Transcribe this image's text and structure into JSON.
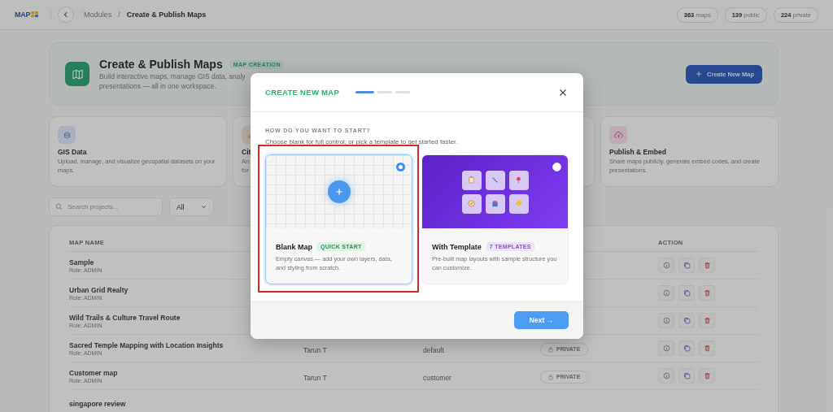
{
  "header": {
    "logo": "MAP",
    "breadcrumb_separator": "/",
    "breadcrumbs": [
      {
        "label": "Modules",
        "current": false
      },
      {
        "label": "Create & Publish Maps",
        "current": true
      }
    ],
    "stats": [
      "**363** maps",
      "**139** public",
      "**224** private"
    ]
  },
  "hero": {
    "title": "Create & Publish Maps",
    "badge": "MAP CREATION",
    "description_lines": [
      "Build interactive maps, manage GIS data, analy",
      "presentations — all in one workspace."
    ],
    "button": "Create New Map"
  },
  "feature_cards": [
    {
      "kind": "data",
      "title": "GIS Data",
      "description": "Upload, manage, and visualize geospatial datasets on your maps."
    },
    {
      "kind": "city",
      "title": "Cit",
      "description_lines": [
        "An",
        "for"
      ]
    },
    {
      "kind": "hidden"
    },
    {
      "kind": "publish",
      "title": "Publish & Embed",
      "description": "Share maps publicly, generate embed codes, and create presentations."
    }
  ],
  "search": {
    "placeholder": "Search projects...",
    "filter": "All"
  },
  "table": {
    "columns": [
      "MAP NAME",
      "ACTION"
    ],
    "rows": [
      {
        "name": "Sample",
        "role": "Role: ADMIN"
      },
      {
        "name": "Urban Grid Realty",
        "role": "Role: ADMIN"
      },
      {
        "name": "Wild Trails & Culture Travel Route",
        "role": "Role: ADMIN"
      },
      {
        "name": "Sacred Temple Mapping with Location Insights",
        "role": "Role: ADMIN",
        "owner": "Tarun T",
        "type": "default",
        "visibility": "PRIVATE"
      },
      {
        "name": "Customer map",
        "role": "Role: ADMIN",
        "owner": "Tarun T",
        "type": "customer",
        "visibility": "PRIVATE"
      },
      {
        "name": "singapore review"
      }
    ]
  },
  "modal": {
    "title": "CREATE NEW MAP",
    "steps": [
      {
        "active": true
      },
      {
        "active": false
      },
      {
        "active": false
      }
    ],
    "question": "HOW DO YOU WANT TO START?",
    "subtitle": "Choose blank for full control, or pick a template to get started faster.",
    "options": [
      {
        "kind": "blank",
        "title": "Blank Map",
        "badge": "QUICK START",
        "description": "Empty canvas — add your own layers, data, and styling from scratch.",
        "selected": true,
        "highlighted": true
      },
      {
        "kind": "template",
        "title": "With Template",
        "badge": "7 TEMPLATES",
        "description": "Pre-built map layouts with sample structure you can customize.",
        "selected": false,
        "highlighted": false
      }
    ],
    "next_button": "Next →"
  }
}
